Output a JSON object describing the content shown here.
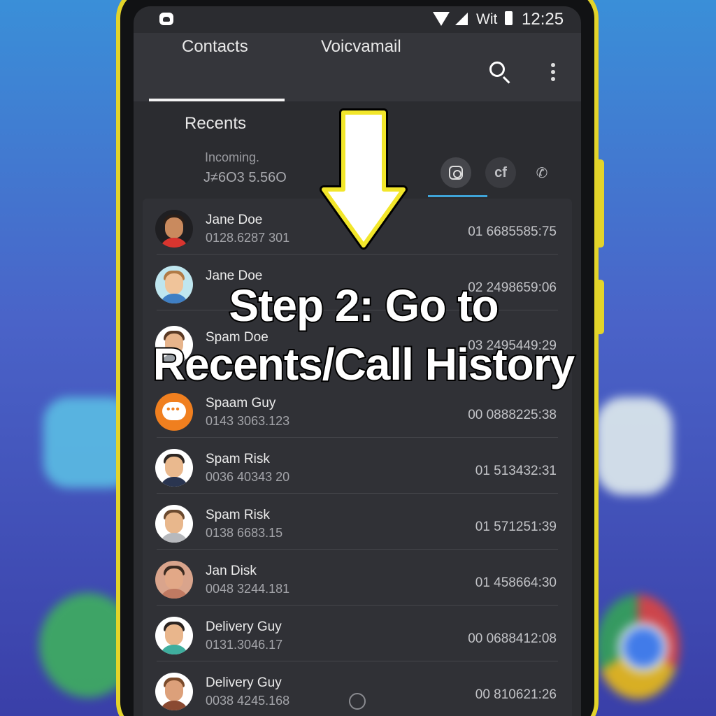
{
  "statusbar": {
    "carrier_text": "Wit",
    "time": "12:25"
  },
  "tabs": [
    {
      "label": "Contacts"
    },
    {
      "label": "Voicvamail"
    }
  ],
  "header_icons": [
    "search-icon",
    "overflow-menu-icon"
  ],
  "recents": {
    "title": "Recents",
    "incoming_label": "Incoming.",
    "incoming_number": "J≠6O3 5.56O",
    "filters": [
      "instagram-icon",
      "facebook-icon",
      "phone-icon"
    ],
    "filter_fb_text": "cf"
  },
  "calls": [
    {
      "name": "Jane Doe",
      "number": "0128.6287 301",
      "time": "01 6685585:75"
    },
    {
      "name": "Jane Doe",
      "number": "",
      "time": "02 2498659:06"
    },
    {
      "name": "Spam Doe",
      "number": "",
      "time": "03 2495449:29"
    },
    {
      "name": "Spaam Guy",
      "number": "0143 3063.123",
      "time": "00 0888225:38"
    },
    {
      "name": "Spam Risk",
      "number": "0036 40343 20",
      "time": "01 513432:31"
    },
    {
      "name": "Spam Risk",
      "number": "0138 6683.15",
      "time": "01 571251:39"
    },
    {
      "name": "Jan Disk",
      "number": "0048 3244.181",
      "time": "01 458664:30"
    },
    {
      "name": "Delivery Guy",
      "number": "0131.3046.17",
      "time": "00 0688412:08"
    },
    {
      "name": "Delivery Guy",
      "number": "0038 4245.168",
      "time": "00 810621:26"
    }
  ],
  "caption": {
    "line1": "Step 2: Go to",
    "line2": "Recents/Call History"
  },
  "colors": {
    "frame": "#e3d42a",
    "screen": "#2b2c30",
    "accent_underline": "#3fa4d8",
    "arrow_outline": "#f2e62a"
  }
}
